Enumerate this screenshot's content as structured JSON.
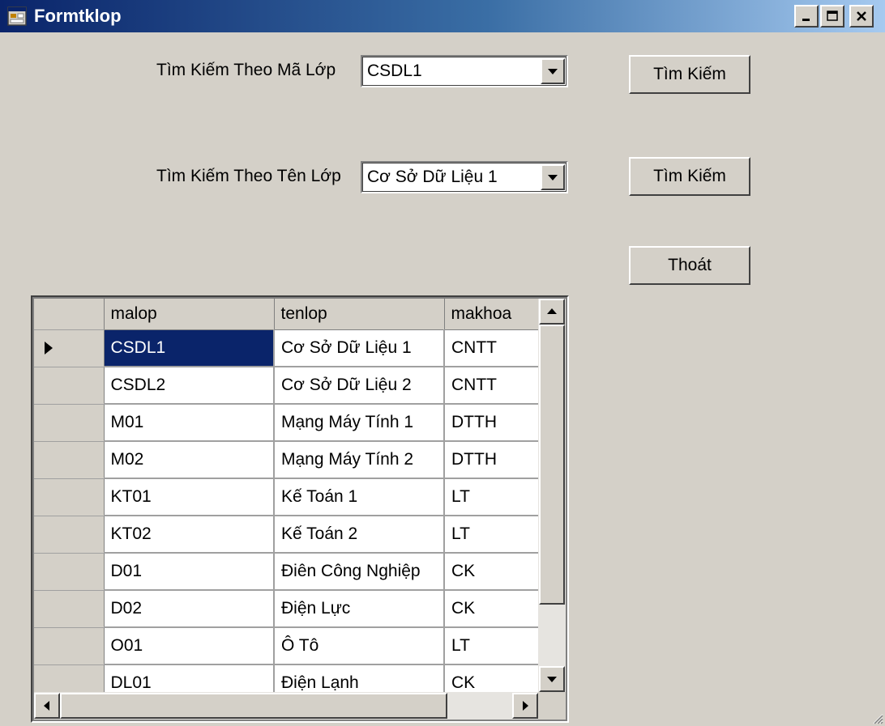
{
  "window": {
    "title": "Formtklop"
  },
  "search_by_code": {
    "label": "Tìm Kiếm Theo Mã Lớp",
    "selected": "CSDL1",
    "button_label": "Tìm Kiếm"
  },
  "search_by_name": {
    "label": "Tìm Kiếm Theo Tên Lớp",
    "selected": "Cơ Sở Dữ Liệu 1",
    "button_label": "Tìm Kiếm"
  },
  "exit_button": {
    "label": "Thoát"
  },
  "grid": {
    "columns": [
      "malop",
      "tenlop",
      "makhoa"
    ],
    "rows": [
      [
        "CSDL1",
        "Cơ Sở Dữ Liệu 1",
        "CNTT"
      ],
      [
        "CSDL2",
        "Cơ Sở Dữ Liệu 2",
        "CNTT"
      ],
      [
        "M01",
        "Mạng Máy Tính 1",
        "DTTH"
      ],
      [
        "M02",
        "Mạng Máy Tính 2",
        "DTTH"
      ],
      [
        "KT01",
        "Kế Toán 1",
        "LT"
      ],
      [
        "KT02",
        "Kế Toán 2",
        "LT"
      ],
      [
        "D01",
        "Điên Công Nghiệp",
        "CK"
      ],
      [
        "D02",
        "Điện Lực",
        "CK"
      ],
      [
        "O01",
        "Ô Tô",
        "LT"
      ],
      [
        "DL01",
        "Điện Lạnh",
        "CK"
      ]
    ]
  },
  "colors": {
    "title_bar": "#0a246a",
    "face": "#d4d0c8",
    "selection": "#0a246a"
  },
  "icons": [
    "app-form-icon",
    "minimize-icon",
    "maximize-icon",
    "close-icon",
    "dropdown-arrow-icon",
    "row-indicator-icon",
    "scroll-up-icon",
    "scroll-down-icon",
    "scroll-left-icon",
    "scroll-right-icon",
    "resize-grip-icon"
  ]
}
